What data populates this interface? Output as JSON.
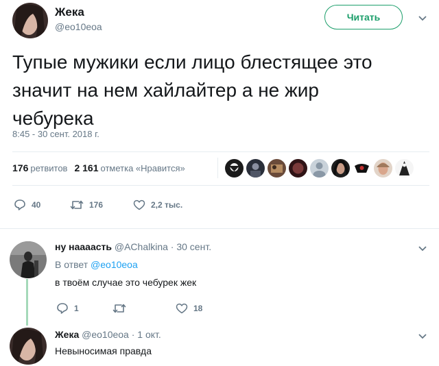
{
  "tweet": {
    "author_name": "Жека",
    "author_handle": "@eo10eoa",
    "follow_label": "Читать",
    "text_lines": [
      "Тупые мужики если лицо блестящее это",
      "значит на нем хайлайтер а не жир",
      "чебурека"
    ],
    "timestamp": "8:45 - 30 сент. 2018 г.",
    "retweets_count": "176",
    "retweets_label": "ретвитов",
    "likes_count": "2 161",
    "likes_label": "отметка «Нравится»",
    "actions": {
      "replies": "40",
      "retweets": "176",
      "likes": "2,2 тыс."
    }
  },
  "replies": [
    {
      "name": "ну наааасть",
      "handle": "@AChalkina",
      "time": "· 30 сент.",
      "reply_to_prefix": "В ответ",
      "reply_to_handle": "@eo10eoa",
      "text": "в твоём случае это чебурек жек",
      "actions": {
        "replies": "1",
        "retweets": "",
        "likes": "18"
      }
    },
    {
      "name": "Жека",
      "handle": "@eo10eoa",
      "time": "· 1 окт.",
      "text": "Невыносимая правда"
    }
  ],
  "colors": {
    "accent_green": "#1b9e6a",
    "link_blue": "#1da1f2",
    "muted_text": "#657786",
    "thread_line": "#a4d9b9"
  },
  "icons": [
    "chevron-down-icon",
    "reply-icon",
    "retweet-icon",
    "heart-icon"
  ]
}
